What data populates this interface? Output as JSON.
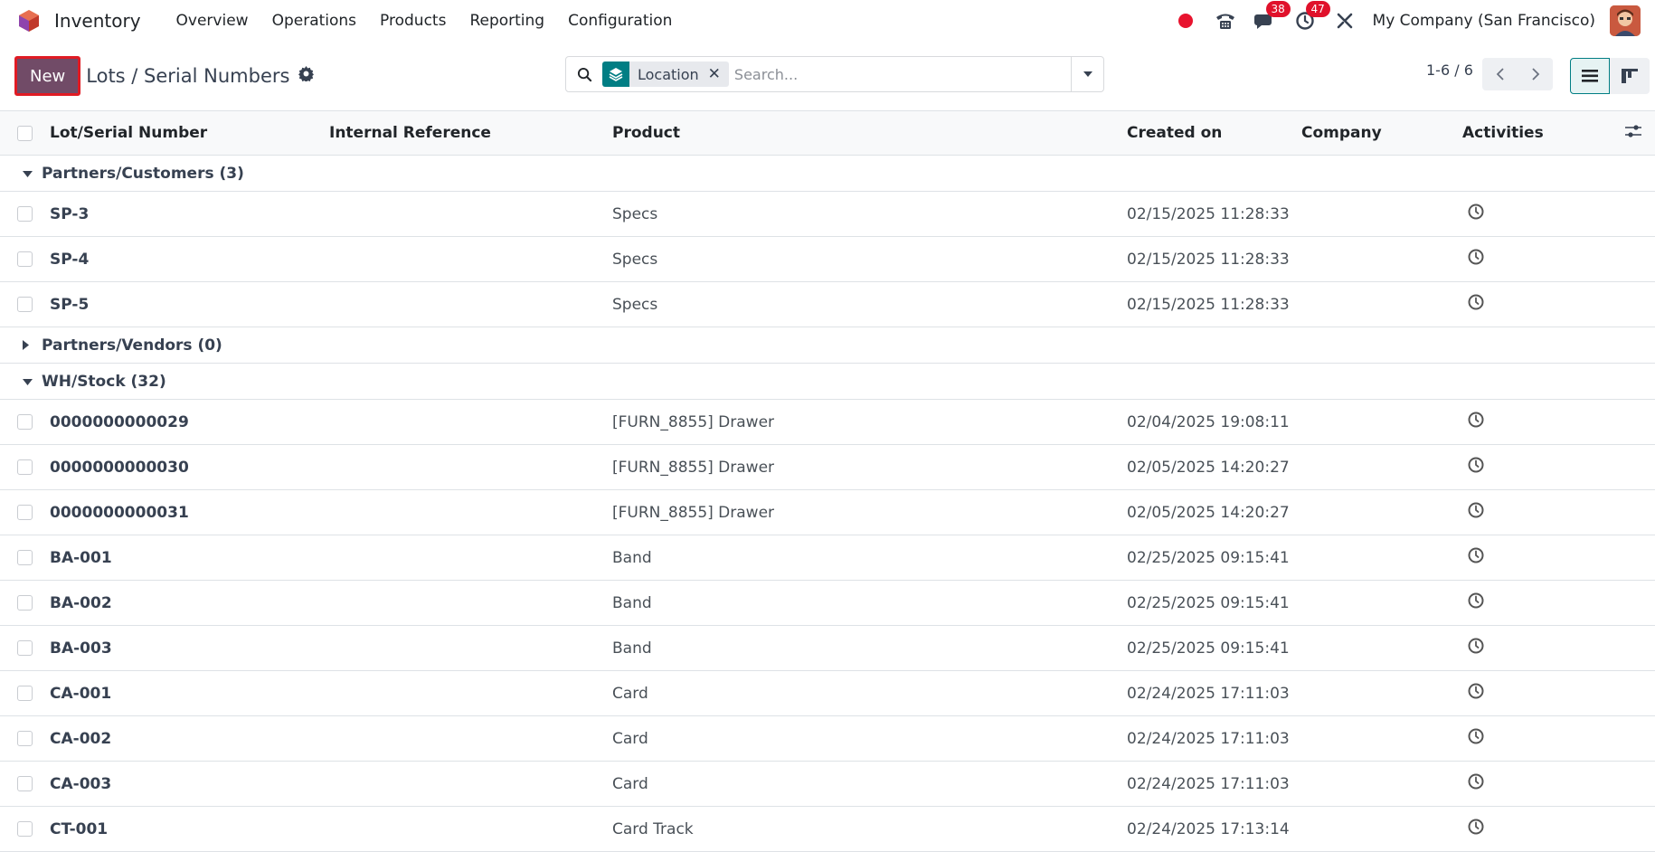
{
  "app": {
    "name": "Inventory"
  },
  "nav": {
    "items": [
      "Overview",
      "Operations",
      "Products",
      "Reporting",
      "Configuration"
    ]
  },
  "systray": {
    "messages_count": "38",
    "activities_count": "47",
    "company": "My Company (San Francisco)"
  },
  "control": {
    "new_label": "New",
    "breadcrumb": "Lots / Serial Numbers",
    "facet_label": "Location",
    "search_placeholder": "Search...",
    "pager": "1-6 / 6"
  },
  "table": {
    "columns": [
      "Lot/Serial Number",
      "Internal Reference",
      "Product",
      "Created on",
      "Company",
      "Activities"
    ],
    "groups": [
      {
        "label": "Partners/Customers (3)",
        "expanded": true,
        "rows": [
          {
            "lot": "SP-3",
            "ref": "",
            "product": "Specs",
            "created": "02/15/2025 11:28:33",
            "company": ""
          },
          {
            "lot": "SP-4",
            "ref": "",
            "product": "Specs",
            "created": "02/15/2025 11:28:33",
            "company": ""
          },
          {
            "lot": "SP-5",
            "ref": "",
            "product": "Specs",
            "created": "02/15/2025 11:28:33",
            "company": ""
          }
        ]
      },
      {
        "label": "Partners/Vendors (0)",
        "expanded": false,
        "rows": []
      },
      {
        "label": "WH/Stock (32)",
        "expanded": true,
        "rows": [
          {
            "lot": "0000000000029",
            "ref": "",
            "product": "[FURN_8855] Drawer",
            "created": "02/04/2025 19:08:11",
            "company": ""
          },
          {
            "lot": "0000000000030",
            "ref": "",
            "product": "[FURN_8855] Drawer",
            "created": "02/05/2025 14:20:27",
            "company": ""
          },
          {
            "lot": "0000000000031",
            "ref": "",
            "product": "[FURN_8855] Drawer",
            "created": "02/05/2025 14:20:27",
            "company": ""
          },
          {
            "lot": "BA-001",
            "ref": "",
            "product": "Band",
            "created": "02/25/2025 09:15:41",
            "company": ""
          },
          {
            "lot": "BA-002",
            "ref": "",
            "product": "Band",
            "created": "02/25/2025 09:15:41",
            "company": ""
          },
          {
            "lot": "BA-003",
            "ref": "",
            "product": "Band",
            "created": "02/25/2025 09:15:41",
            "company": ""
          },
          {
            "lot": "CA-001",
            "ref": "",
            "product": "Card",
            "created": "02/24/2025 17:11:03",
            "company": ""
          },
          {
            "lot": "CA-002",
            "ref": "",
            "product": "Card",
            "created": "02/24/2025 17:11:03",
            "company": ""
          },
          {
            "lot": "CA-003",
            "ref": "",
            "product": "Card",
            "created": "02/24/2025 17:11:03",
            "company": ""
          },
          {
            "lot": "CT-001",
            "ref": "",
            "product": "Card Track",
            "created": "02/24/2025 17:13:14",
            "company": ""
          }
        ]
      }
    ]
  },
  "colors": {
    "brand": "#714b67",
    "accent": "#017e84",
    "badge": "#e0112b"
  }
}
